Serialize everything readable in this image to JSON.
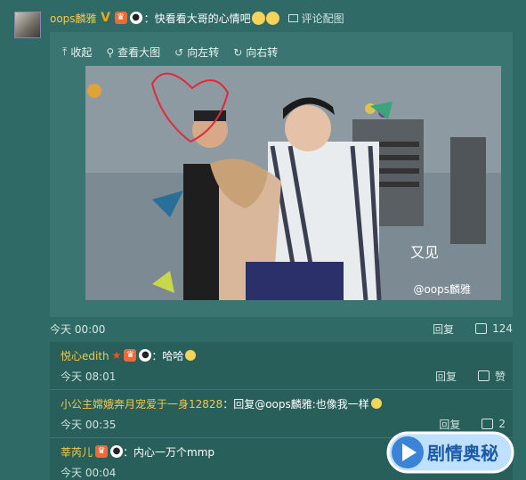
{
  "post": {
    "username": "oops麟雅",
    "text": "：快看看大哥的心情吧",
    "pic_comment": "评论配图",
    "toolbar": {
      "collapse": "收起",
      "view_large": "查看大图",
      "rotate_left": "向左转",
      "rotate_right": "向右转"
    },
    "watermark": "@oops麟雅",
    "overlay_text": "又见",
    "time": "今天 00:00",
    "reply": "回复",
    "likes": "124"
  },
  "comments": [
    {
      "name": "悦心edith",
      "text": "：哈哈",
      "time": "今天 08:01",
      "reply": "回复",
      "likes": "赞"
    },
    {
      "name": "小公主嫦娥奔月宠爱于一身12828",
      "text": "：回复@oops麟雅:也像我一样",
      "time": "今天 00:35",
      "reply": "回复",
      "likes": "2"
    },
    {
      "name": "莘芮儿",
      "text": "：内心一万个mmp",
      "time": "今天 00:04"
    }
  ],
  "logo": {
    "text": "剧情奥秘"
  },
  "colors": {
    "background": "#2f6a66",
    "username": "#f2c94c",
    "accent": "#f06a35"
  }
}
